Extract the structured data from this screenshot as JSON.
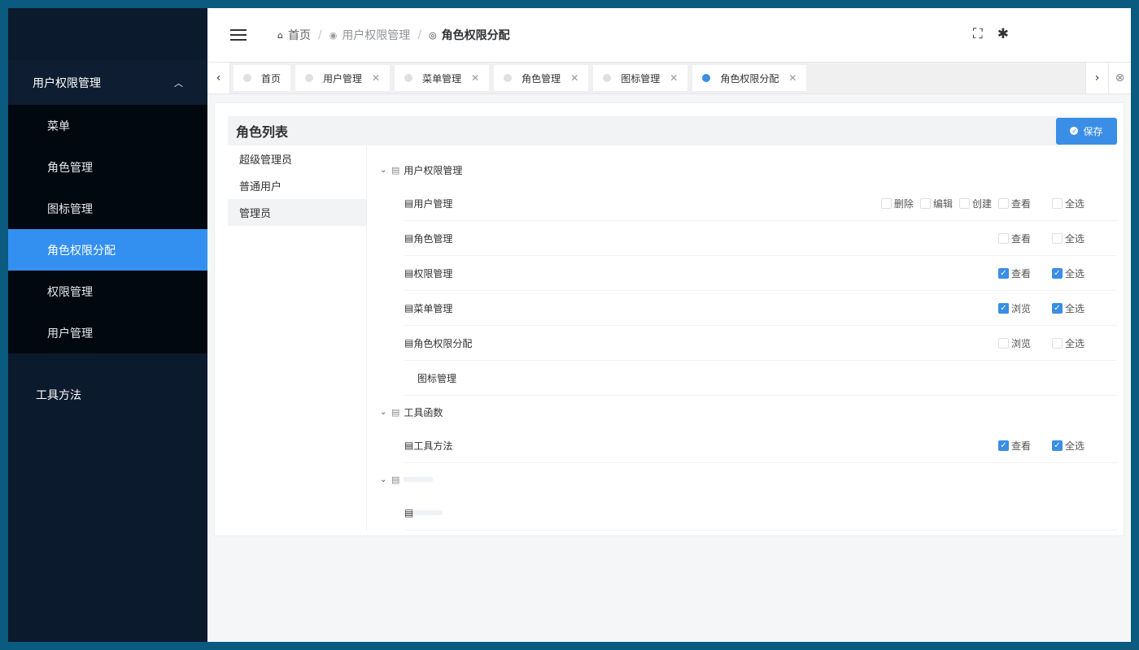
{
  "sidebar": {
    "group_label": "用户权限管理",
    "items": [
      "菜单",
      "角色管理",
      "图标管理",
      "角色权限分配",
      "权限管理",
      "用户管理"
    ],
    "tool_label": "工具方法"
  },
  "breadcrumb": {
    "home": "首页",
    "parent": "用户权限管理",
    "current": "角色权限分配"
  },
  "tags": [
    {
      "label": "首页",
      "closable": false
    },
    {
      "label": "用户管理",
      "closable": true
    },
    {
      "label": "菜单管理",
      "closable": true
    },
    {
      "label": "角色管理",
      "closable": true
    },
    {
      "label": "图标管理",
      "closable": true
    },
    {
      "label": "角色权限分配",
      "closable": true
    }
  ],
  "card": {
    "title": "角色列表",
    "save_label": "保存"
  },
  "roles": [
    "超级管理员",
    "普通用户",
    "管理员"
  ],
  "tree": {
    "group1": {
      "label": "用户权限管理",
      "children": [
        {
          "label": "用户管理",
          "perms": [
            {
              "label": "删除",
              "checked": false
            },
            {
              "label": "编辑",
              "checked": false
            },
            {
              "label": "创建",
              "checked": false
            },
            {
              "label": "查看",
              "checked": false
            }
          ],
          "all_label": "全选",
          "all_checked": false
        },
        {
          "label": "角色管理",
          "perms": [
            {
              "label": "查看",
              "checked": false
            }
          ],
          "all_label": "全选",
          "all_checked": false
        },
        {
          "label": "权限管理",
          "perms": [
            {
              "label": "查看",
              "checked": true
            }
          ],
          "all_label": "全选",
          "all_checked": true
        },
        {
          "label": "菜单管理",
          "perms": [
            {
              "label": "浏览",
              "checked": true
            }
          ],
          "all_label": "全选",
          "all_checked": true
        },
        {
          "label": "角色权限分配",
          "perms": [
            {
              "label": "浏览",
              "checked": false
            }
          ],
          "all_label": "全选",
          "all_checked": false
        },
        {
          "label": "图标管理",
          "perms": [],
          "all_label": "",
          "all_checked": false
        }
      ]
    },
    "group2": {
      "label": "工具函数",
      "children": [
        {
          "label": "工具方法",
          "perms": [
            {
              "label": "查看",
              "checked": true
            }
          ],
          "all_label": "全选",
          "all_checked": true
        }
      ]
    }
  },
  "icons": {
    "home": "home-icon",
    "fullscreen": "fullscreen-icon",
    "bug": "bug-icon",
    "accent": "#3a8ee6"
  }
}
